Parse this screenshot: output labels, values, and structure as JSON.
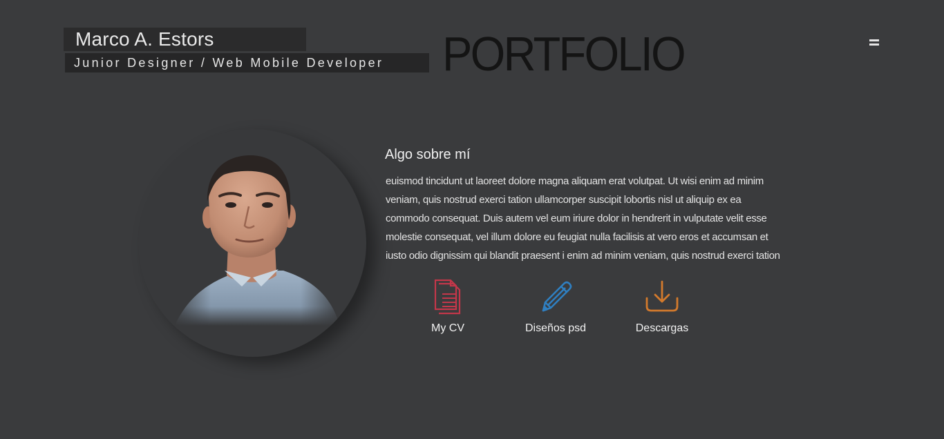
{
  "header": {
    "name": "Marco A. Estors",
    "role": "Junior Designer / Web Mobile Developer",
    "logo": "PORTFOLIO",
    "menu_icon": "hamburger-menu-icon"
  },
  "about": {
    "title": "Algo sobre mí",
    "lines": [
      "euismod tincidunt ut laoreet dolore magna aliquam erat volutpat. Ut wisi enim ad minim",
      "veniam, quis nostrud exerci tation ullamcorper suscipit lobortis nisl ut aliquip ex ea",
      "commodo consequat. Duis autem vel eum iriure dolor in hendrerit in vulputate velit esse",
      "molestie consequat, vel illum dolore eu feugiat nulla facilisis at vero eros et accumsan et",
      "iusto odio dignissim qui blandit praesent i enim ad minim veniam, quis nostrud exerci tation"
    ]
  },
  "actions": [
    {
      "label": "My CV",
      "icon": "document-icon",
      "color": "#c4374a"
    },
    {
      "label": "Diseños psd",
      "icon": "pencil-icon",
      "color": "#2f7fc1"
    },
    {
      "label": "Descargas",
      "icon": "download-icon",
      "color": "#d37a2c"
    }
  ],
  "colors": {
    "background": "#3a3b3d",
    "label_bg": "#2b2b2c",
    "text": "#e6e6e6"
  }
}
